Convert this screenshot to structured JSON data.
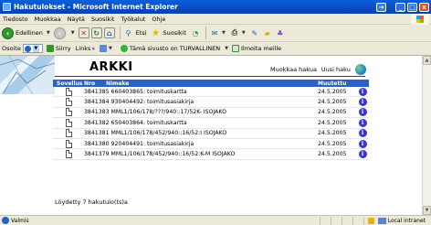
{
  "window": {
    "title": "Hakutulokset - Microsoft Internet Explorer",
    "back_glyph": "→",
    "min_glyph": "_",
    "max_glyph": "□",
    "close_glyph": "x"
  },
  "menu": [
    "Tiedosto",
    "Muokkaa",
    "Näytä",
    "Suosikit",
    "Työkalut",
    "Ohje"
  ],
  "toolbar": {
    "back_label": "Edellinen",
    "search_label": "Etsi",
    "favorites_label": "Suosikit"
  },
  "addressbar": {
    "label": "Osoite",
    "goto_label": "Siirry",
    "links_label": "Links",
    "safety_label": "Tämä sivusto on TURVALLINEN",
    "feedback_label": "Ilmoita meille"
  },
  "page": {
    "app_name": "ARKKI",
    "edit_search_label": "Muokkaa hakua",
    "new_search_label": "Uusi haku",
    "columns": {
      "app": "Sovellus",
      "number": "Nro",
      "name": "Nimeke",
      "modified": "Muutettu"
    },
    "results": [
      {
        "text": "3841385 660403865: toimituskartta",
        "date": "24.5.2005"
      },
      {
        "text": "3841384 930404492: toimitusasiakirja",
        "date": "24.5.2005"
      },
      {
        "text": "3841383 MML1/106/178/???/940::17/52K- ISOJAKO",
        "date": "24.5.2005"
      },
      {
        "text": "3841382 650403864: toimituskartta",
        "date": "24.5.2005"
      },
      {
        "text": "3841381 MML1/106/178/452/940::16/52:I ISOJAKO",
        "date": "24.5.2005"
      },
      {
        "text": "3841380 920404491: toimitusasiakirja",
        "date": "24.5.2005"
      },
      {
        "text": "3841379 MML1/106/178/452/940::16/52:K-M ISOJAKO",
        "date": "24.5.2005"
      }
    ],
    "info_glyph": "i",
    "found_text": "Löydetty 7 hakutulo(ts)a"
  },
  "status": {
    "text": "Valmis",
    "zone": "Local intranet"
  },
  "colors": {
    "title_bar": "#0a5fdc",
    "table_header": "#2a62c4",
    "info_icon": "#3a36c9"
  }
}
